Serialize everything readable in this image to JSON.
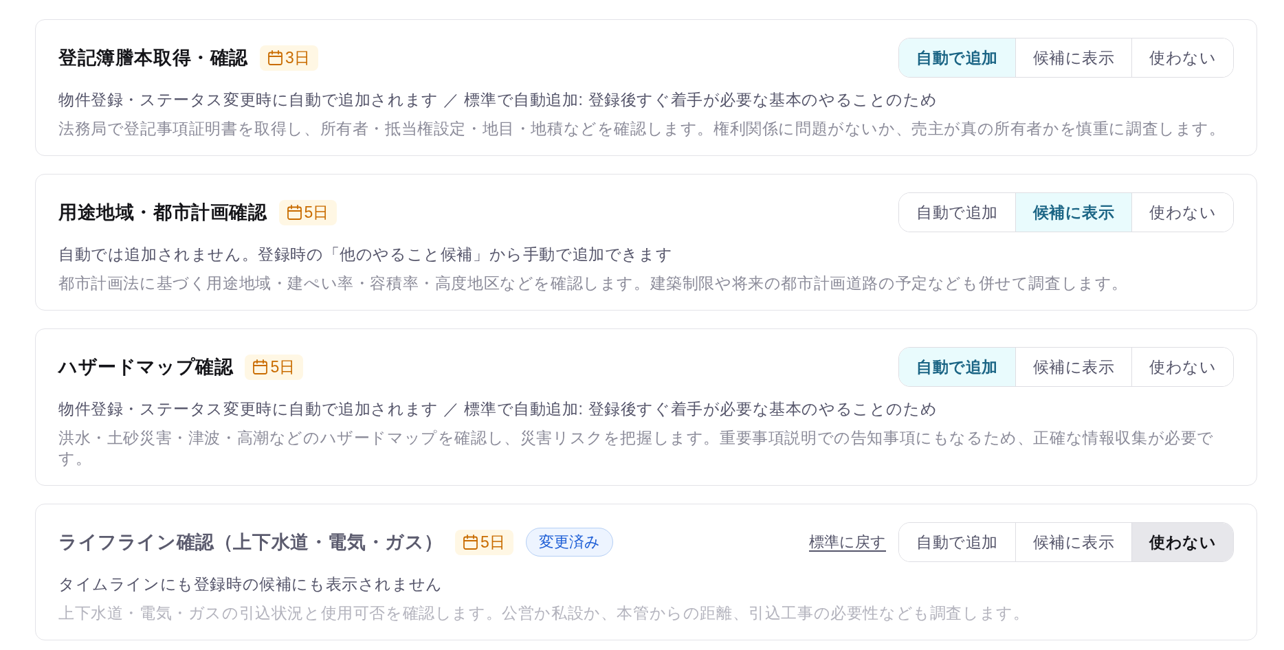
{
  "tasks": [
    {
      "title": "登記簿謄本取得・確認",
      "duration": "3日",
      "disabled": false,
      "modes": [
        {
          "label": "自動で追加",
          "selected": true
        },
        {
          "label": "候補に表示",
          "selected": false
        },
        {
          "label": "使わない",
          "selected": false
        }
      ],
      "behavior": "物件登録・ステータス変更時に自動で追加されます ／ 標準で自動追加: 登録後すぐ着手が必要な基本のやることのため",
      "detail": "法務局で登記事項証明書を取得し、所有者・抵当権設定・地目・地積などを確認します。権利関係に問題がないか、売主が真の所有者かを慎重に調査します。"
    },
    {
      "title": "用途地域・都市計画確認",
      "duration": "5日",
      "disabled": false,
      "modes": [
        {
          "label": "自動で追加",
          "selected": false
        },
        {
          "label": "候補に表示",
          "selected": true
        },
        {
          "label": "使わない",
          "selected": false
        }
      ],
      "behavior": "自動では追加されません。登録時の「他のやること候補」から手動で追加できます",
      "detail": "都市計画法に基づく用途地域・建ぺい率・容積率・高度地区などを確認します。建築制限や将来の都市計画道路の予定なども併せて調査します。"
    },
    {
      "title": "ハザードマップ確認",
      "duration": "5日",
      "disabled": false,
      "modes": [
        {
          "label": "自動で追加",
          "selected": true
        },
        {
          "label": "候補に表示",
          "selected": false
        },
        {
          "label": "使わない",
          "selected": false
        }
      ],
      "behavior": "物件登録・ステータス変更時に自動で追加されます ／ 標準で自動追加: 登録後すぐ着手が必要な基本のやることのため",
      "detail": "洪水・土砂災害・津波・高潮などのハザードマップを確認し、災害リスクを把握します。重要事項説明での告知事項にもなるため、正確な情報収集が必要です。"
    },
    {
      "title": "ライフライン確認（上下水道・電気・ガス）",
      "duration": "5日",
      "tag": "変更済み",
      "reset_link": "標準に戻す",
      "disabled": true,
      "modes": [
        {
          "label": "自動で追加",
          "selected": false
        },
        {
          "label": "候補に表示",
          "selected": false
        },
        {
          "label": "使わない",
          "selected": true
        }
      ],
      "behavior": "タイムラインにも登録時の候補にも表示されません",
      "detail": "上下水道・電気・ガスの引込状況と使用可否を確認します。公営か私設か、本管からの距離、引込工事の必要性なども調査します。"
    }
  ]
}
